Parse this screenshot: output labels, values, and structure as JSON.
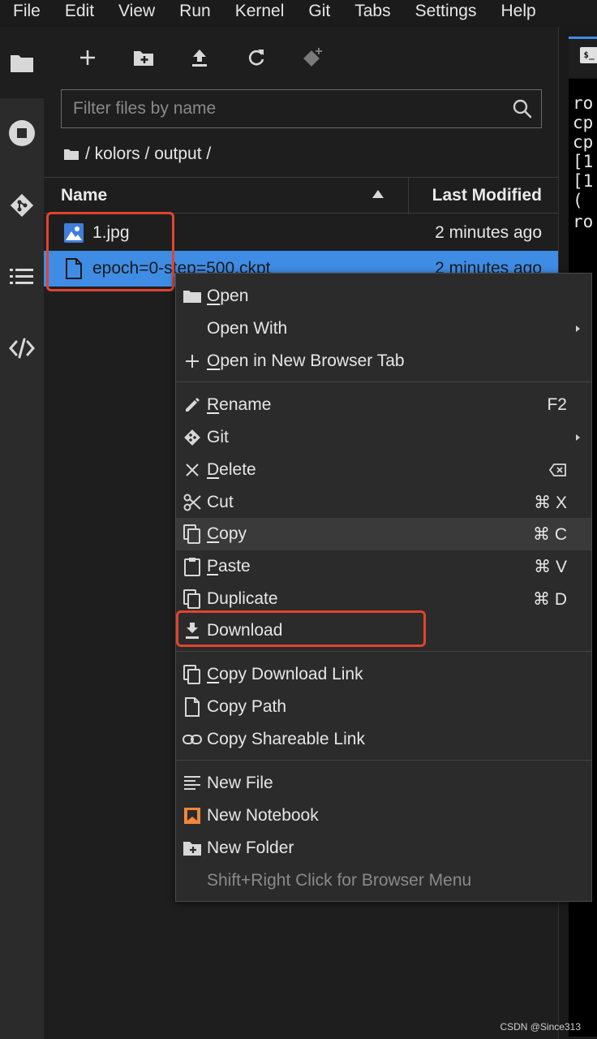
{
  "menubar": {
    "items": [
      "File",
      "Edit",
      "View",
      "Run",
      "Kernel",
      "Git",
      "Tabs",
      "Settings",
      "Help"
    ]
  },
  "activity_bar": {
    "icons": [
      "folder-icon",
      "stop-circle-icon",
      "git-icon",
      "list-icon",
      "code-icon"
    ]
  },
  "toolbar": {
    "icons": [
      "plus-icon",
      "new-folder-icon",
      "upload-icon",
      "refresh-icon",
      "git-clone-icon"
    ]
  },
  "search": {
    "placeholder": "Filter files by name"
  },
  "breadcrumb": {
    "path": "/ kolors / output /"
  },
  "file_list": {
    "col_name": "Name",
    "col_modified": "Last Modified",
    "rows": [
      {
        "name": "1.jpg",
        "modified": "2 minutes ago",
        "icon": "image-file-icon",
        "selected": false
      },
      {
        "name": "epoch=0-step=500.ckpt",
        "modified": "2 minutes ago",
        "icon": "file-icon",
        "selected": true
      }
    ]
  },
  "terminal": {
    "tab_icon_text": "$_",
    "lines": [
      "ro",
      "cp",
      "cp",
      "[1",
      "[1",
      " (",
      "ro"
    ]
  },
  "context_menu": {
    "items": [
      {
        "label_u": "O",
        "label_rest": "pen",
        "shortcut": "",
        "icon": "folder-icon"
      },
      {
        "label_u": "",
        "label_rest": "Open With",
        "shortcut": "",
        "icon": "",
        "submenu": true
      },
      {
        "label_u": "O",
        "label_rest": "pen in New Browser Tab",
        "shortcut": "",
        "icon": "plus-icon"
      },
      {
        "label_u": "R",
        "label_rest": "ename",
        "shortcut": "F2",
        "icon": "pencil-icon"
      },
      {
        "label_u": "",
        "label_rest": "Git",
        "shortcut": "",
        "icon": "git-icon",
        "submenu": true
      },
      {
        "label_u": "D",
        "label_rest": "elete",
        "shortcut": "",
        "icon": "close-icon"
      },
      {
        "label_u": "",
        "label_rest": "Cut",
        "shortcut": "⌘ X",
        "icon": "scissors-icon"
      },
      {
        "label_u": "C",
        "label_rest": "opy",
        "shortcut": "⌘ C",
        "icon": "copy-icon"
      },
      {
        "label_u": "P",
        "label_rest": "aste",
        "shortcut": "⌘ V",
        "icon": "clipboard-icon"
      },
      {
        "label_u": "",
        "label_rest": "Duplicate",
        "shortcut": "⌘ D",
        "icon": "duplicate-icon"
      },
      {
        "label_u": "",
        "label_rest": "Download",
        "shortcut": "",
        "icon": "download-icon"
      },
      {
        "label_u": "C",
        "label_rest": "opy Download Link",
        "shortcut": "",
        "icon": "copy-icon"
      },
      {
        "label_u": "",
        "label_rest": "Copy Path",
        "shortcut": "",
        "icon": "file-icon"
      },
      {
        "label_u": "",
        "label_rest": "Copy Shareable Link",
        "shortcut": "",
        "icon": "link-icon"
      },
      {
        "label_u": "",
        "label_rest": "New File",
        "shortcut": "",
        "icon": "text-lines-icon"
      },
      {
        "label_u": "",
        "label_rest": "New Notebook",
        "shortcut": "",
        "icon": "notebook-icon"
      },
      {
        "label_u": "",
        "label_rest": "New Folder",
        "shortcut": "",
        "icon": "new-folder-icon"
      },
      {
        "label_u": "",
        "label_rest": "Shift+Right Click for Browser Menu",
        "shortcut": "",
        "icon": "",
        "disabled": true
      }
    ]
  },
  "colors": {
    "selection": "#3f8ce5",
    "highlight_box": "#e2432e",
    "notebook_icon": "#f0873a"
  },
  "watermark": "CSDN @Since313"
}
